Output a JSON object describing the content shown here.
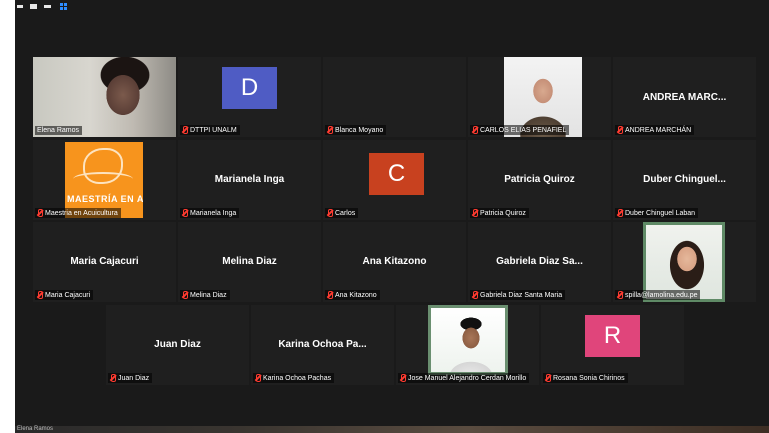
{
  "topbar": {
    "icons": [
      "minimize-icon",
      "restore-icon",
      "maximize-icon",
      "gallery-view-icon"
    ]
  },
  "participants": [
    {
      "key": "elena",
      "label": "Elena Ramos",
      "display": "video"
    },
    {
      "key": "dttpi",
      "label": "DTTPI UNALM",
      "display": "avatar",
      "initial": "D",
      "color": "#4f5cc4"
    },
    {
      "key": "blanca",
      "label": "Blanca Moyano",
      "display": "blank"
    },
    {
      "key": "carlos-elias",
      "label": "CARLOS ELIAS PENAFIEL",
      "display": "photo"
    },
    {
      "key": "andrea",
      "label": "ANDREA MARCHÁN",
      "display": "name",
      "center_name": "ANDREA  MARC..."
    },
    {
      "key": "maestria",
      "label": "Maestria en Acuicultura",
      "display": "logo",
      "logo_text": "MAESTRÍA EN ACUICULTURA"
    },
    {
      "key": "marianela",
      "label": "Marianela Inga",
      "display": "name",
      "center_name": "Marianela Inga"
    },
    {
      "key": "carlos",
      "label": "Carlos",
      "display": "avatar",
      "initial": "C",
      "color": "#c8411f"
    },
    {
      "key": "patricia",
      "label": "Patricia Quiroz",
      "display": "name",
      "center_name": "Patricia Quiroz"
    },
    {
      "key": "duber",
      "label": "Duber Chinguel Laban",
      "display": "name",
      "center_name": "Duber  Chinguel..."
    },
    {
      "key": "maria",
      "label": "Maria Cajacuri",
      "display": "name",
      "center_name": "Maria Cajacuri"
    },
    {
      "key": "melina",
      "label": "Melina Diaz",
      "display": "name",
      "center_name": "Melina Diaz"
    },
    {
      "key": "ana",
      "label": "Ana Kitazono",
      "display": "name",
      "center_name": "Ana Kitazono"
    },
    {
      "key": "gabriela",
      "label": "Gabriela Diaz Santa Maria",
      "display": "name",
      "center_name": "Gabriela  Diaz Sa..."
    },
    {
      "key": "spilla",
      "label": "spilla@lamolina.edu.pe",
      "display": "photo"
    },
    {
      "key": "juan",
      "label": "Juan Diaz",
      "display": "name",
      "center_name": "Juan Diaz"
    },
    {
      "key": "karina",
      "label": "Karina Ochoa Pachas",
      "display": "name",
      "center_name": "Karina  Ochoa  Pa..."
    },
    {
      "key": "jose",
      "label": "Jose Manuel Alejandro Cerdan Morillo",
      "display": "photo"
    },
    {
      "key": "rosana",
      "label": "Rosana Sonia Chirinos",
      "display": "avatar",
      "initial": "R",
      "color": "#e0457b"
    }
  ],
  "self_view": {
    "label": "Elena Ramos"
  },
  "colors": {
    "active_speaker": "#b5c23a",
    "muted": "#ff3b30",
    "background": "#1a1a1a"
  }
}
